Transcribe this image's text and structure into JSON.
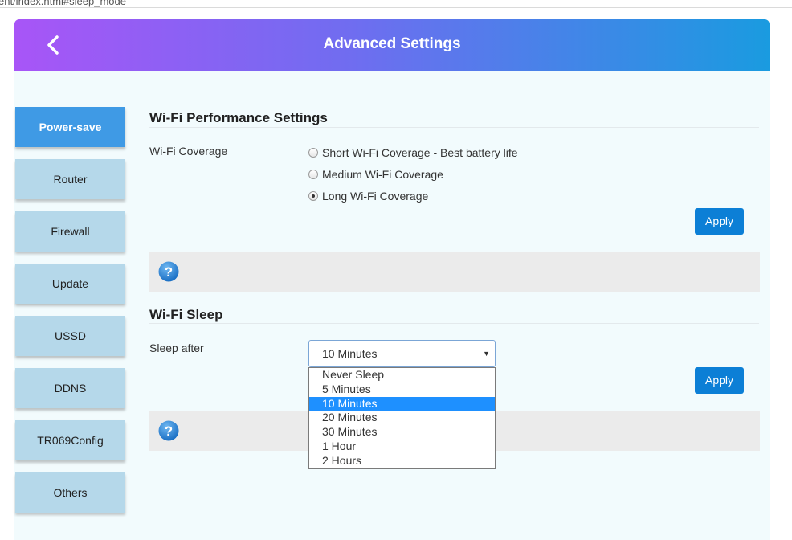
{
  "browser": {
    "url_fragment": "ent/index.html#sleep_mode"
  },
  "header": {
    "title": "Advanced Settings",
    "back_icon": "chevron-left-icon"
  },
  "sidebar": {
    "items": [
      {
        "label": "Power-save",
        "active": true
      },
      {
        "label": "Router",
        "active": false
      },
      {
        "label": "Firewall",
        "active": false
      },
      {
        "label": "Update",
        "active": false
      },
      {
        "label": "USSD",
        "active": false
      },
      {
        "label": "DDNS",
        "active": false
      },
      {
        "label": "TR069Config",
        "active": false
      },
      {
        "label": "Others",
        "active": false
      }
    ],
    "active_color": "#3f9ae5",
    "inactive_color": "#b5d8ea"
  },
  "performance": {
    "title": "Wi-Fi Performance Settings",
    "label": "Wi-Fi Coverage",
    "options": [
      {
        "label": "Short Wi-Fi Coverage - Best battery life",
        "checked": false
      },
      {
        "label": "Medium Wi-Fi Coverage",
        "checked": false
      },
      {
        "label": "Long Wi-Fi Coverage",
        "checked": true
      }
    ],
    "apply_label": "Apply"
  },
  "sleep": {
    "title": "Wi-Fi Sleep",
    "label": "Sleep after",
    "selected": "10 Minutes",
    "options": [
      "Never Sleep",
      "5 Minutes",
      "10 Minutes",
      "20 Minutes",
      "30 Minutes",
      "1 Hour",
      "2 Hours"
    ],
    "selected_index": 2,
    "apply_label": "Apply"
  },
  "help_icon": "question-mark-icon",
  "accent_color": "#0c7fd6"
}
